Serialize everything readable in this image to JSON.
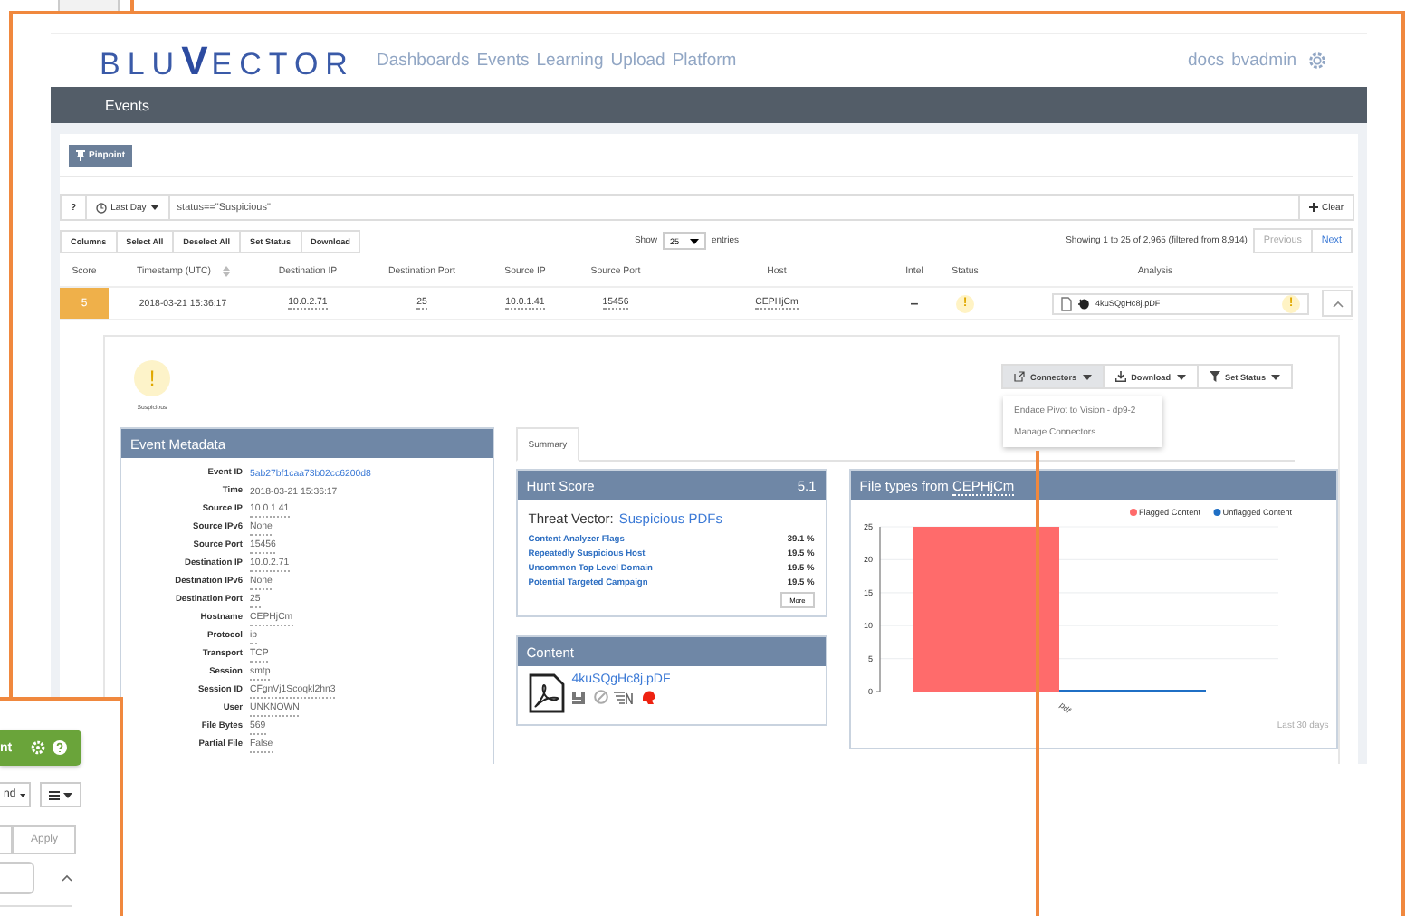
{
  "logo": {
    "left": "BLU",
    "mark": "V",
    "right": "ECTOR"
  },
  "nav": [
    "Dashboards",
    "Events",
    "Learning",
    "Upload",
    "Platform"
  ],
  "user_links": [
    "docs",
    "bvadmin"
  ],
  "page_title": "Events",
  "pinpoint_button": "Pinpoint",
  "filter": {
    "help": "?",
    "range": "Last Day",
    "query": "status==\"Suspicious\"",
    "clear": "Clear"
  },
  "table_buttons": [
    "Columns",
    "Select All",
    "Deselect All",
    "Set Status",
    "Download"
  ],
  "length": {
    "show": "Show",
    "value": "25",
    "entries": "entries"
  },
  "info": "Showing 1 to 25 of 2,965 (filtered from 8,914)",
  "pagination": [
    {
      "label": "Previous",
      "disabled": true
    },
    {
      "label": "Next",
      "disabled": false
    }
  ],
  "table": {
    "columns": [
      {
        "label": "Score",
        "sortable": false
      },
      {
        "label": "Timestamp (UTC)",
        "sortable": true
      },
      {
        "label": "Destination IP",
        "sortable": false
      },
      {
        "label": "Destination Port",
        "sortable": false
      },
      {
        "label": "Source IP",
        "sortable": false
      },
      {
        "label": "Source Port",
        "sortable": false
      },
      {
        "label": "Host",
        "sortable": false
      },
      {
        "label": "Intel",
        "sortable": false
      },
      {
        "label": "Status",
        "sortable": false
      },
      {
        "label": "Analysis",
        "sortable": false
      }
    ],
    "rows": [
      {
        "cells": [
          {
            "kind": "score",
            "text": "5",
            "color": "#efb04a"
          },
          {
            "kind": "text",
            "text": "2018-03-21 15:36:17",
            "dotted": false
          },
          {
            "kind": "text",
            "text": "10.0.2.71",
            "dotted": true
          },
          {
            "kind": "text",
            "text": "25",
            "dotted": true
          },
          {
            "kind": "text",
            "text": "10.0.1.41",
            "dotted": true
          },
          {
            "kind": "text",
            "text": "15456",
            "dotted": true
          },
          {
            "kind": "text",
            "text": "CEPHjCm",
            "dotted": true
          },
          {
            "kind": "intel",
            "text": "–"
          },
          {
            "kind": "status",
            "text": "!"
          },
          {
            "kind": "analysis",
            "text": "4kuSQgHc8j.pDF",
            "flag": "!"
          }
        ],
        "expanded": true
      }
    ]
  },
  "detail": {
    "verdict": {
      "icon": "!",
      "label": "Suspicious"
    },
    "actions": [
      {
        "label": "Connectors",
        "kind": "link",
        "open": true
      },
      {
        "label": "Download",
        "kind": "download",
        "open": false
      },
      {
        "label": "Set Status",
        "kind": "filter",
        "open": false
      }
    ],
    "menu": [
      "Endace Pivot to Vision - dp9-2",
      "Manage Connectors"
    ],
    "metadata": {
      "title": "Event Metadata",
      "rows": [
        {
          "label": "Event ID",
          "value": "5ab27bf1caa73b02cc6200d8",
          "kind": "link"
        },
        {
          "label": "Time",
          "value": "2018-03-21 15:36:17",
          "kind": "plain"
        },
        {
          "label": "Source IP",
          "value": "10.0.1.41",
          "kind": "dotted"
        },
        {
          "label": "Source IPv6",
          "value": "None",
          "kind": "dotted"
        },
        {
          "label": "Source Port",
          "value": "15456",
          "kind": "dotted"
        },
        {
          "label": "Destination IP",
          "value": "10.0.2.71",
          "kind": "dotted"
        },
        {
          "label": "Destination IPv6",
          "value": "None",
          "kind": "dotted"
        },
        {
          "label": "Destination Port",
          "value": "25",
          "kind": "dotted"
        },
        {
          "label": "Hostname",
          "value": "CEPHjCm",
          "kind": "dotted"
        },
        {
          "label": "Protocol",
          "value": "ip",
          "kind": "dotted"
        },
        {
          "label": "Transport",
          "value": "TCP",
          "kind": "dotted"
        },
        {
          "label": "Session",
          "value": "smtp",
          "kind": "dotted"
        },
        {
          "label": "Session ID",
          "value": "CFgnVj1Scoqkl2hn3",
          "kind": "dotted"
        },
        {
          "label": "User",
          "value": "UNKNOWN",
          "kind": "dotted"
        },
        {
          "label": "File Bytes",
          "value": "569",
          "kind": "dotted"
        },
        {
          "label": "Partial File",
          "value": "False",
          "kind": "dotted"
        }
      ]
    },
    "tabs": [
      {
        "label": "Summary",
        "selected": true
      }
    ],
    "hunt": {
      "title": "Hunt Score",
      "score": "5.1",
      "vector_label": "Threat Vector:",
      "vector": "Suspicious PDFs",
      "factors": [
        {
          "name": "Content Analyzer Flags",
          "value": "39.1 %"
        },
        {
          "name": "Repeatedly Suspicious Host",
          "value": "19.5 %"
        },
        {
          "name": "Uncommon Top Level Domain",
          "value": "19.5 %"
        },
        {
          "name": "Potential Targeted Campaign",
          "value": "19.5 %"
        }
      ],
      "more": "More"
    },
    "content": {
      "title": "Content",
      "file": "4kuSQgHc8j.pDF"
    },
    "chart": {
      "title": "File types from",
      "host": "CEPHjCm",
      "footer": "Last 30 days",
      "chart_data": {
        "type": "bar",
        "categories": [
          "pdf"
        ],
        "series": [
          {
            "name": "Flagged Content",
            "color": "#ff6b6b",
            "values": [
              25
            ]
          },
          {
            "name": "Unflagged Content",
            "color": "#1f6fc5",
            "values": [
              0
            ]
          }
        ],
        "ylim": [
          0,
          25
        ],
        "yticks": [
          0,
          5,
          10,
          15,
          20,
          25
        ],
        "grid": true,
        "legend": true
      }
    }
  },
  "side_panel": {
    "title": "nt",
    "dropdown": "nd",
    "apply": "Apply"
  }
}
